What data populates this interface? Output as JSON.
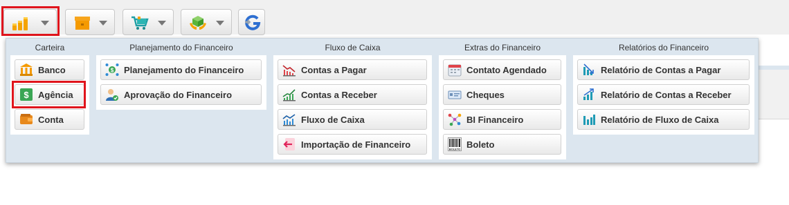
{
  "toolbar": {
    "buttons": [
      {
        "name": "financeiro-icon",
        "selected": true
      },
      {
        "name": "box-icon"
      },
      {
        "name": "cart-icon"
      },
      {
        "name": "hands-cube-icon"
      },
      {
        "name": "g-sync-icon"
      }
    ],
    "highlight_color": "#e0141c"
  },
  "menu": {
    "carteira": {
      "title": "Carteira",
      "items": [
        {
          "label": "Banco",
          "icon": "bank-icon"
        },
        {
          "label": "Agência",
          "icon": "dollar-icon",
          "highlighted": true
        },
        {
          "label": "Conta",
          "icon": "wallet-icon"
        }
      ]
    },
    "planejamento": {
      "title": "Planejamento do Financeiro",
      "items": [
        {
          "label": "Planejamento do Financeiro",
          "icon": "network-dollar-icon"
        },
        {
          "label": "Aprovação do Financeiro",
          "icon": "user-approve-icon"
        }
      ]
    },
    "fluxo": {
      "title": "Fluxo de Caixa",
      "items": [
        {
          "label": "Contas a Pagar",
          "icon": "chart-down-icon"
        },
        {
          "label": "Contas a Receber",
          "icon": "chart-up-icon"
        },
        {
          "label": "Fluxo de Caixa",
          "icon": "chart-flow-icon"
        },
        {
          "label": "Importação de Financeiro",
          "icon": "import-icon"
        }
      ]
    },
    "extras": {
      "title": "Extras do Financeiro",
      "items": [
        {
          "label": "Contato Agendado",
          "icon": "calendar-icon"
        },
        {
          "label": "Cheques",
          "icon": "cheque-icon"
        },
        {
          "label": "BI Financeiro",
          "icon": "bi-icon"
        },
        {
          "label": "Boleto",
          "icon": "barcode-icon",
          "sublabel": "BOLETO"
        }
      ]
    },
    "relatorios": {
      "title": "Relatórios do Financeiro",
      "items": [
        {
          "label": "Relatório de Contas a Pagar",
          "icon": "report-pay-icon"
        },
        {
          "label": "Relatório de Contas a Receber",
          "icon": "report-receive-icon"
        },
        {
          "label": "Relatório de Fluxo de Caixa",
          "icon": "report-flow-icon"
        }
      ]
    }
  }
}
